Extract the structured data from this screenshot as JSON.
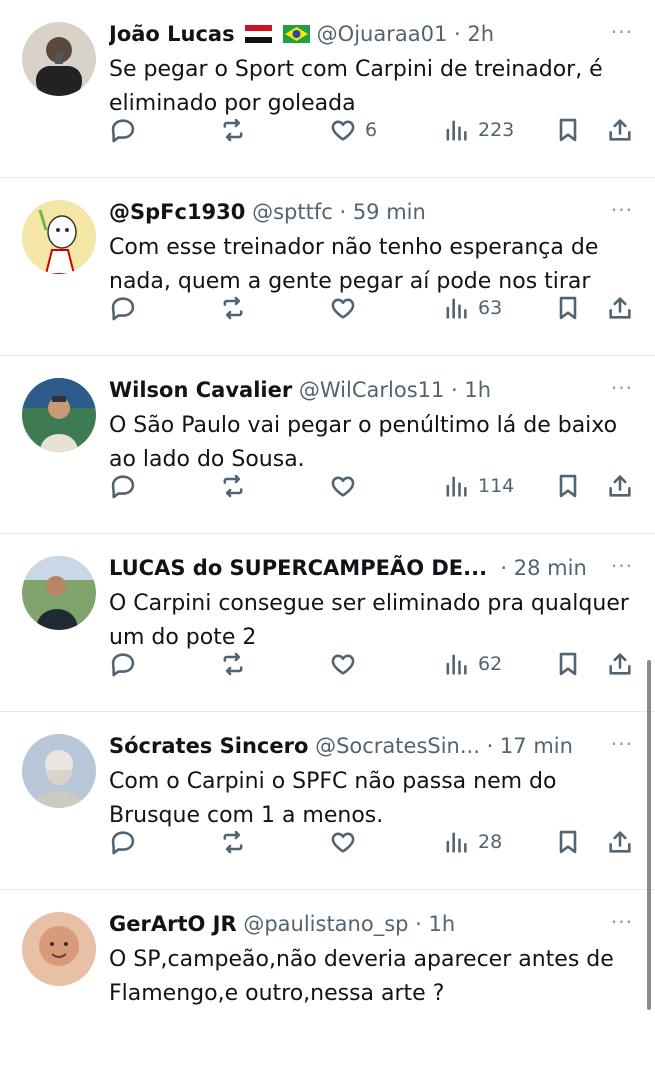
{
  "tweets": [
    {
      "name": "João Lucas",
      "handle": "@Ojuaraa01",
      "time": "2h",
      "flags": [
        "egypt-flag-icon",
        "brazil-flag-icon"
      ],
      "text": "Se pegar o Sport com Carpini de treinador, é eliminado por goleada",
      "likes": "6",
      "views": "223",
      "avatar_color": "#d8d2c8"
    },
    {
      "name": "@SpFc1930",
      "handle": "@spttfc",
      "time": "59 min",
      "text": "Com esse treinador não tenho esperança de nada, quem a gente pegar aí pode nos tirar",
      "likes": "",
      "views": "63",
      "avatar_color": "#f4e7a6"
    },
    {
      "name": "Wilson Cavalier",
      "handle": "@WilCarlos11",
      "time": "1h",
      "text": "O São Paulo vai pegar o penúltimo lá de baixo ao lado do Sousa.",
      "likes": "",
      "views": "114",
      "avatar_color": "#3e7a52"
    },
    {
      "name": "LUCAS do SUPERCAMPEÃO DE...",
      "handle": "",
      "time": "28 min",
      "text": "O Carpini consegue ser eliminado pra qualquer um do pote 2",
      "likes": "",
      "views": "62",
      "avatar_color": "#7fa36a"
    },
    {
      "name": "Sócrates Sincero",
      "handle": "@SocratesSin...",
      "time": "17 min",
      "text": "Com o Carpini o SPFC não passa nem do Brusque com 1 a menos.",
      "likes": "",
      "views": "28",
      "avatar_color": "#b9c6d8"
    },
    {
      "name": "GerArtO JR",
      "handle": "@paulistano_sp",
      "time": "1h",
      "text": "O SP,campeão,não deveria aparecer antes de Flamengo,e outro,nessa arte ?",
      "likes": "",
      "views": "",
      "avatar_color": "#e7c0a6"
    }
  ],
  "separator": "·",
  "more_label": "···",
  "colors": {
    "text": "#0f1419",
    "muted": "#536471",
    "divider": "#e6e9ec"
  }
}
